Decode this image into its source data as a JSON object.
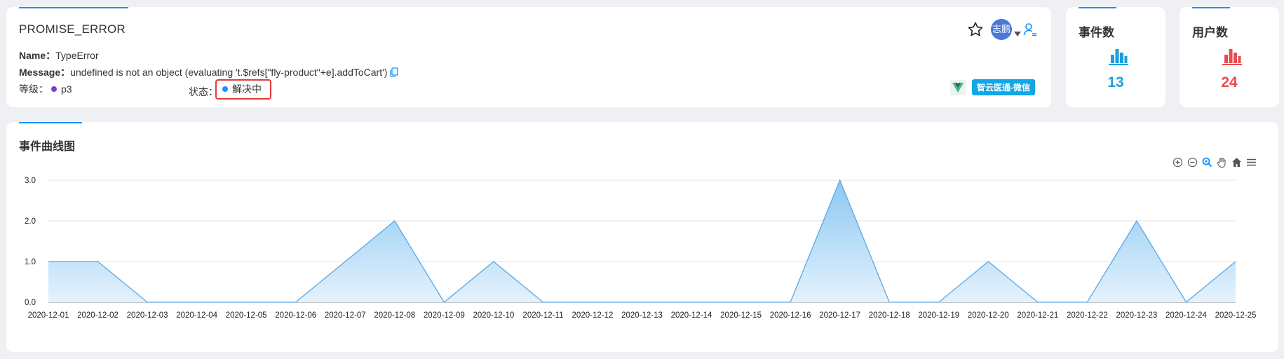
{
  "error": {
    "title": "PROMISE_ERROR",
    "name_label": "Name：",
    "name_value": "TypeError",
    "message_label": "Message：",
    "message_value": "undefined is not an object (evaluating 't.$refs[\"fly-product\"+e].addToCart')",
    "level_label": "等级：",
    "level_value": "p3",
    "status_label": "状态：",
    "status_value": "解决中",
    "assignee_avatar": "志鹏",
    "project_badge": "智云医通-微信",
    "colors": {
      "level_dot": "#7b3fbf",
      "status_dot": "#1890ff",
      "status_highlight": "#e23b3b"
    }
  },
  "stats": {
    "events": {
      "title": "事件数",
      "value": "13",
      "color": "#1aa0dc",
      "icon": "bar-chart-icon"
    },
    "users": {
      "title": "用户数",
      "value": "24",
      "color": "#e84d4d",
      "icon": "bar-chart-icon"
    }
  },
  "chart_section": {
    "title": "事件曲线图"
  },
  "toolbox": [
    "zoom-in-icon",
    "zoom-out-icon",
    "zoom-search-icon",
    "pan-hand-icon",
    "home-icon",
    "menu-icon"
  ],
  "chart_data": {
    "type": "area",
    "title": "",
    "xlabel": "",
    "ylabel": "",
    "ylim": [
      0,
      3
    ],
    "yticks": [
      "0.0",
      "1.0",
      "2.0",
      "3.0"
    ],
    "grid": true,
    "categories": [
      "2020-12-01",
      "2020-12-02",
      "2020-12-03",
      "2020-12-04",
      "2020-12-05",
      "2020-12-06",
      "2020-12-07",
      "2020-12-08",
      "2020-12-09",
      "2020-12-10",
      "2020-12-11",
      "2020-12-12",
      "2020-12-13",
      "2020-12-14",
      "2020-12-15",
      "2020-12-16",
      "2020-12-17",
      "2020-12-18",
      "2020-12-19",
      "2020-12-20",
      "2020-12-21",
      "2020-12-22",
      "2020-12-23",
      "2020-12-24",
      "2020-12-25"
    ],
    "series": [
      {
        "values": [
          1,
          1,
          0,
          0,
          0,
          0,
          1,
          2,
          0,
          1,
          0,
          0,
          0,
          0,
          0,
          0,
          3,
          0,
          0,
          1,
          0,
          0,
          2,
          0,
          1
        ]
      }
    ],
    "colors": {
      "line": "#5aa8e6",
      "fill_top": "#8cc8f4",
      "fill_bottom": "#e4f2fc"
    }
  }
}
